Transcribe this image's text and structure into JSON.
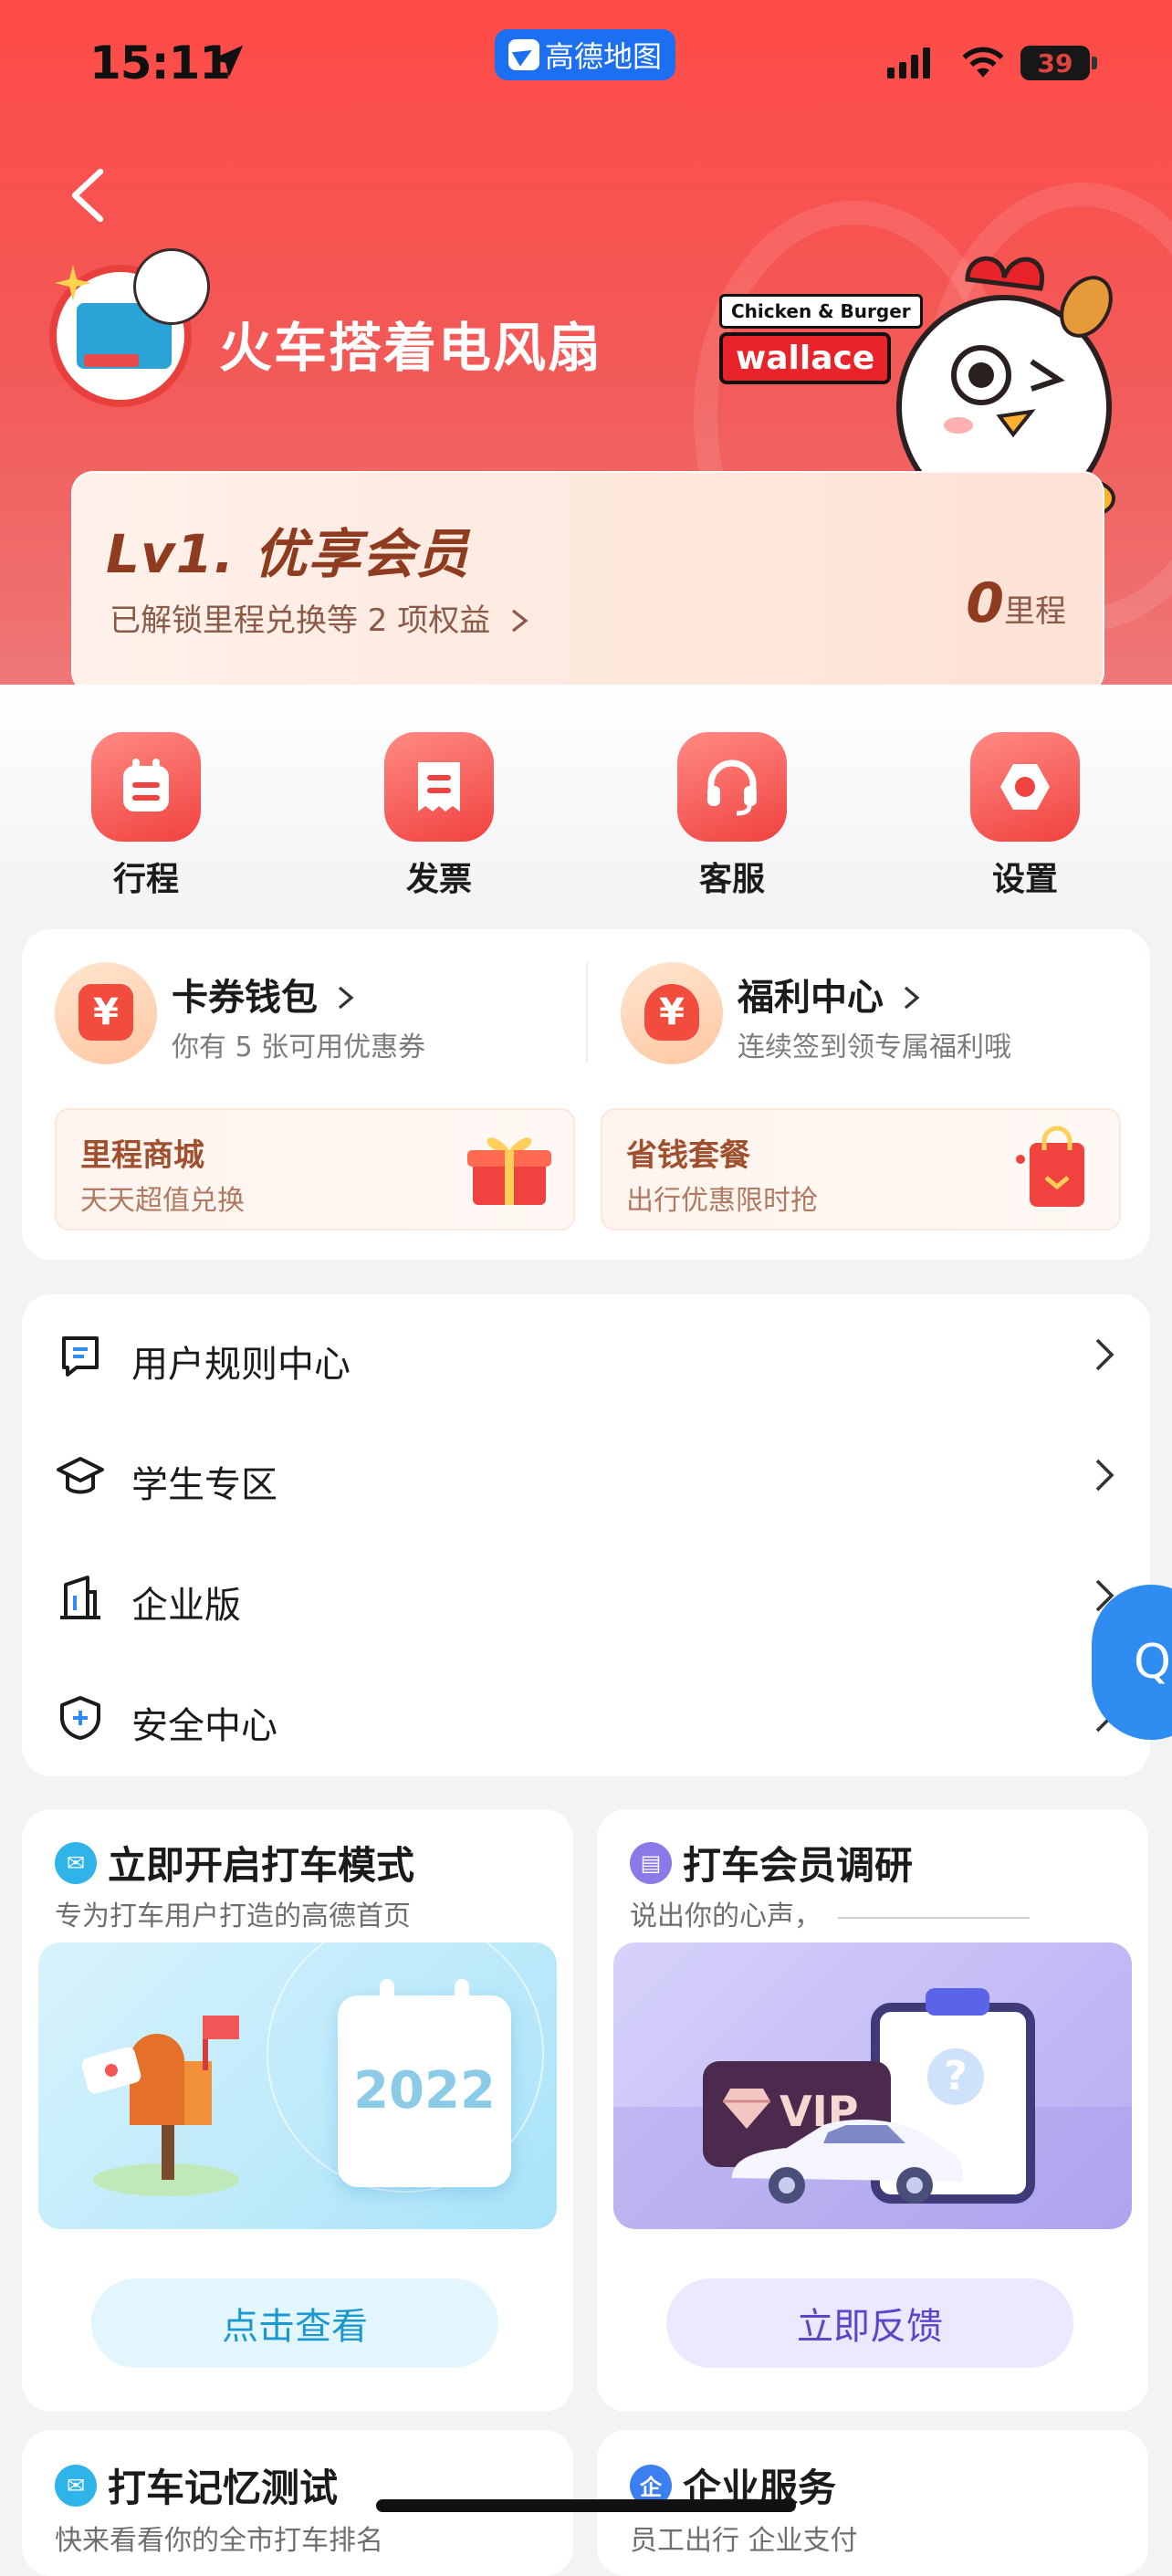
{
  "status_bar": {
    "time": "15:11",
    "battery": "39",
    "back_app": "高德地图"
  },
  "profile": {
    "username": "火车搭着电风扇"
  },
  "brand": {
    "top": "Chicken & Burger",
    "name": "wallace"
  },
  "member": {
    "level": "Lv1. 优享会员",
    "subtitle": "已解锁里程兑换等 2 项权益",
    "miles_value": "0",
    "miles_unit": "里程"
  },
  "quick_actions": [
    {
      "label": "行程",
      "icon": "calendar-icon"
    },
    {
      "label": "发票",
      "icon": "invoice-icon"
    },
    {
      "label": "客服",
      "icon": "headset-icon"
    },
    {
      "label": "设置",
      "icon": "gear-icon"
    }
  ],
  "wallet": {
    "coupon": {
      "title": "卡券钱包",
      "sub": "你有 5 张可用优惠券",
      "glyph": "¥"
    },
    "welfare": {
      "title": "福利中心",
      "sub": "连续签到领专属福利哦",
      "glyph": "¥"
    },
    "mall": {
      "title": "里程商城",
      "sub": "天天超值兑换"
    },
    "package": {
      "title": "省钱套餐",
      "sub": "出行优惠限时抢"
    }
  },
  "menu": [
    {
      "label": "用户规则中心",
      "icon": "rules-icon"
    },
    {
      "label": "学生专区",
      "icon": "graduation-cap-icon"
    },
    {
      "label": "企业版",
      "icon": "building-icon"
    },
    {
      "label": "安全中心",
      "icon": "shield-icon"
    }
  ],
  "promos": {
    "mode": {
      "title": "立即开启打车模式",
      "sub": "专为打车用户打造的高德首页",
      "button": "点击查看",
      "year": "2022"
    },
    "survey": {
      "title": "打车会员调研",
      "sub": "说出你的心声，",
      "button": "立即反馈",
      "badge": "VIP"
    }
  },
  "bottom": {
    "memory": {
      "title": "打车记忆测试",
      "sub": "快来看看你的全市打车排名"
    },
    "enterprise": {
      "title": "企业服务",
      "sub": "员工出行 企业支付"
    }
  },
  "floating": {
    "label": "Q"
  },
  "colors": {
    "brand_red": "#f0423f",
    "accent_blue": "#2f8cf0",
    "survey_purple": "#5b45c9"
  }
}
